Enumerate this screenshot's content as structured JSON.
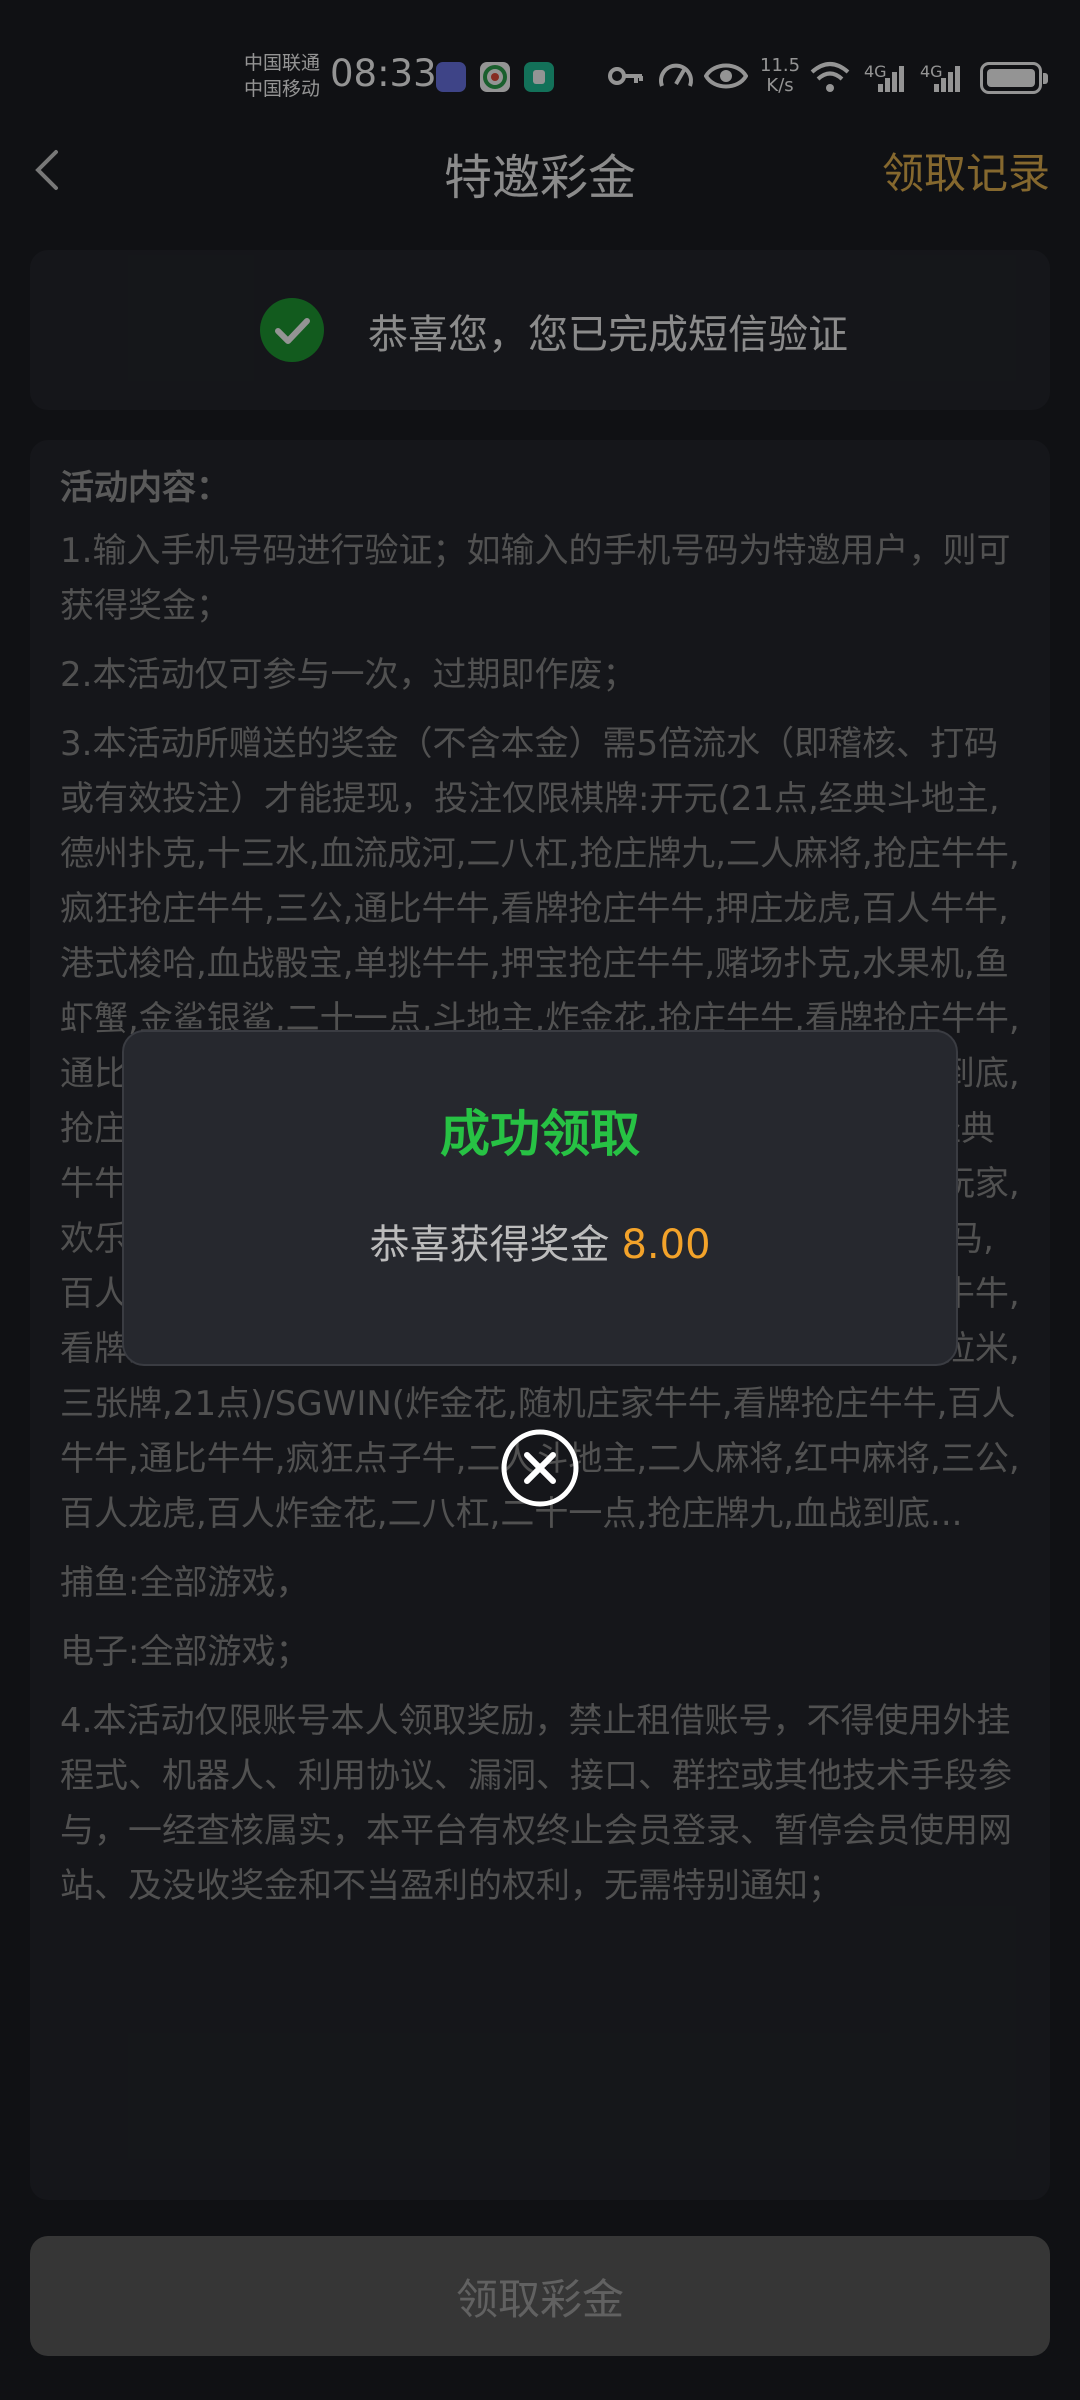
{
  "status_bar": {
    "carrier_1": "中国联通",
    "carrier_2": "中国移动",
    "time": "08:33",
    "net_speed_value": "11.5",
    "net_speed_unit": "K/s",
    "signal_1": "4G",
    "signal_2": "4G",
    "battery_level": 1.0
  },
  "header": {
    "title": "特邀彩金",
    "records_link": "领取记录"
  },
  "verify": {
    "text": "恭喜您，您已完成短信验证"
  },
  "rules": {
    "title": "活动内容：",
    "items": [
      "1.输入手机号码进行验证；如输入的手机号码为特邀用户，则可获得奖金；",
      "2.本活动仅可参与一次，过期即作废；",
      "3.本活动所赠送的奖金（不含本金）需5倍流水（即稽核、打码或有效投注）才能提现，投注仅限棋牌:开元(21点,经典斗地主,德州扑克,十三水,血流成河,二八杠,抢庄牌九,二人麻将,抢庄牛牛,疯狂抢庄牛牛,三公,通比牛牛,看牌抢庄牛牛,押庄龙虎,百人牛牛,港式梭哈,血战骰宝,单挑牛牛,押宝抢庄牛牛,赌场扑克,水果机,鱼虾蟹,金鲨银鲨,二十一点,斗地主,炸金花,抢庄牛牛,看牌抢庄牛牛,通比牛牛,二人麻将,百人牛牛,十三水,德州扑克,二八杠,血战到底,抢庄牌九,21点,斗地主,押庄龙虎,百人牛牛,三公,通比牛牛,经典牛牛,疯狂牛牛,金鲨银鲨,血战骰宝,抢庄选三张,抢红包,癸亥玩家,欢乐炸金花,十点半,骰子牛牛,斗金花,疯狂牛牛)/WG(奔驰宝马,百人牛牛,扫雷红包,赌大小,安达巴哈,七上七下,炸金花,抢庄牛牛,看牌抢庄牛牛,通比牛牛,斗地主,德州扑克,二人麻将,十三水,拉米,三张牌,21点)/SGWIN(炸金花,随机庄家牛牛,看牌抢庄牛牛,百人牛牛,通比牛牛,疯狂点子牛,二人斗地主,二人麻将,红中麻将,三公,百人龙虎,百人炸金花,二八杠,二十一点,抢庄牌九,血战到底...",
      "捕鱼:全部游戏，",
      "电子:全部游戏；",
      "4.本活动仅限账号本人领取奖励，禁止租借账号，不得使用外挂程式、机器人、利用协议、漏洞、接口、群控或其他技术手段参与，一经查核属实，本平台有权终止会员登录、暂停会员使用网站、及没收奖金和不当盈利的权利，无需特别通知；"
    ]
  },
  "dialog": {
    "title": "成功领取",
    "message": "恭喜获得奖金",
    "amount": "8.00"
  },
  "bottom": {
    "claim_label": "领取彩金"
  },
  "colors": {
    "accent_gold": "#e6b450",
    "success_green": "#27c244",
    "amount_orange": "#f3a32a"
  }
}
